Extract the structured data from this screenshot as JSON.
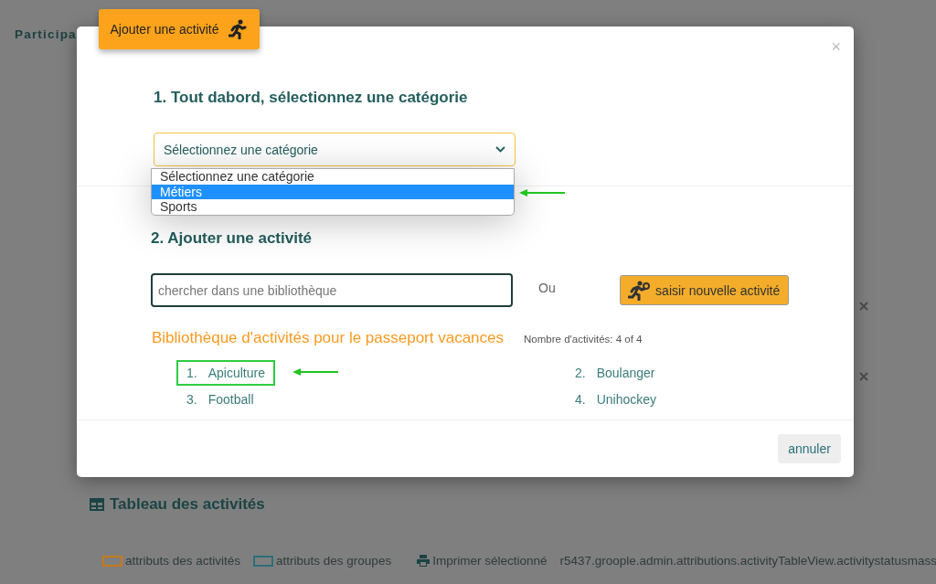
{
  "background": {
    "section_title": "Participa",
    "table_title": "Tableau des activités",
    "legend": [
      {
        "kind": "swatch",
        "label": "attributs des activités",
        "color": "#c8791a"
      },
      {
        "kind": "swatch",
        "label": "attributs des groupes",
        "color": "#2b6f78"
      },
      {
        "kind": "print",
        "label": "Imprimer sélectionné"
      },
      {
        "kind": "text",
        "label": "r5437.groople.admin.attributions.activityTableView.activitystatusmass"
      }
    ]
  },
  "modal": {
    "tag": "Ajouter une activité",
    "close": "×",
    "step1": {
      "title": "1. Tout dabord, sélectionnez une catégorie",
      "select": {
        "value": "Sélectionnez une catégorie",
        "expanded": true,
        "options": [
          {
            "label": "Sélectionnez une catégorie",
            "highlighted": false,
            "annotated": false
          },
          {
            "label": "Métiers",
            "highlighted": true,
            "annotated": true
          },
          {
            "label": "Sports",
            "highlighted": false,
            "annotated": false
          }
        ]
      }
    },
    "step2": {
      "title": "2. Ajouter une activité",
      "search": {
        "placeholder": "chercher dans une bibliothèque"
      },
      "or": "Ou",
      "new_button": "saisir nouvelle activité"
    },
    "library": {
      "title": "Bibliothèque d'activités pour le passeport vacances",
      "count": "Nombre d'activités: 4 of 4",
      "items": [
        {
          "number": "1.",
          "name": "Apiculture",
          "highlighted": true
        },
        {
          "number": "2.",
          "name": "Boulanger",
          "highlighted": false
        },
        {
          "number": "3.",
          "name": "Football",
          "highlighted": false
        },
        {
          "number": "4.",
          "name": "Unihockey",
          "highlighted": false
        }
      ]
    },
    "cancel": "annuler"
  }
}
